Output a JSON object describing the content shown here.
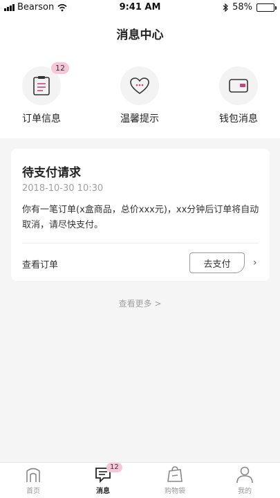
{
  "status_bar": {
    "carrier": "Bearson",
    "time": "9:41 AM",
    "battery": "58%",
    "battery_level": 0.58
  },
  "header": {
    "title": "消息中心"
  },
  "categories": [
    {
      "label": "订单信息",
      "badge": "12",
      "icon": "clipboard-icon"
    },
    {
      "label": "温馨提示",
      "icon": "heart-icon"
    },
    {
      "label": "钱包消息",
      "icon": "wallet-icon"
    }
  ],
  "card": {
    "title": "待支付请求",
    "timestamp": "2018-10-30 10:30",
    "body": "你有一笔订单(x盒商品，总价xxx元)，xx分钟后订单将自动取消，请尽快支付。",
    "view_order": "查看订单",
    "pay_button": "去支付",
    "chevron": "›"
  },
  "more": "查看更多 >",
  "tabbar": {
    "tabs": [
      {
        "label": "首页",
        "icon": "home-icon"
      },
      {
        "label": "消息",
        "icon": "message-icon",
        "badge": "12",
        "active": true
      },
      {
        "label": "购物袋",
        "icon": "shopping-bag-icon"
      },
      {
        "label": "我的",
        "icon": "user-icon"
      }
    ]
  },
  "colors": {
    "badge": "#f6c7d8",
    "accent": "#c8437a",
    "muted": "#a0a0a0"
  }
}
